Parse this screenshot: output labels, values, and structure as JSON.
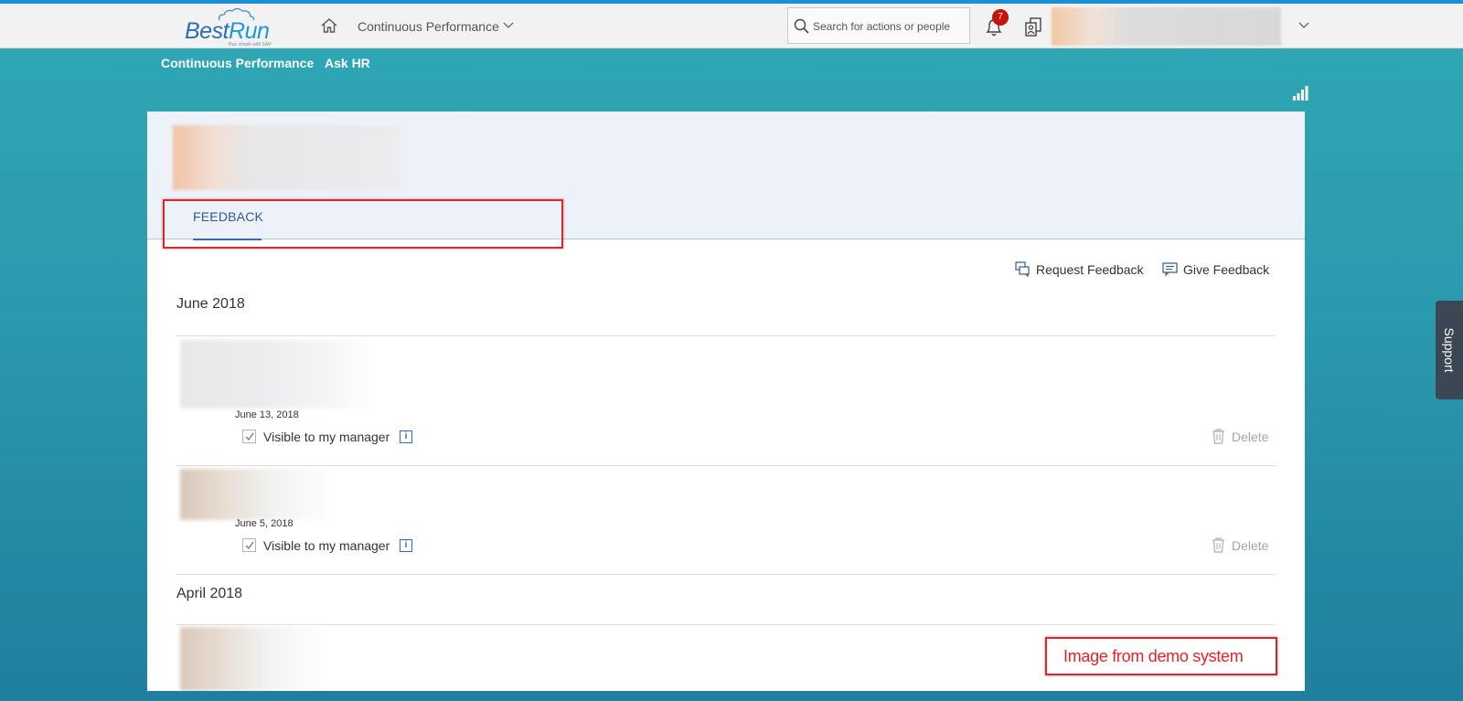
{
  "shell": {
    "logo_best": "Best",
    "logo_run": "Run",
    "logo_tagline": "Run simple with SAP",
    "app_title": "Continuous Performance",
    "search_placeholder": "Search for actions or people",
    "notification_count": "7"
  },
  "subnav": {
    "items": [
      "Continuous Performance",
      "Ask HR"
    ]
  },
  "profile": {
    "tab_label": "FEEDBACK"
  },
  "actions": {
    "request": "Request Feedback",
    "give": "Give Feedback"
  },
  "sections": [
    {
      "title": "June 2018",
      "entries": [
        {
          "date": "June 13, 2018",
          "visible_label": "Visible to my manager",
          "delete_label": "Delete",
          "visible_checked": true
        },
        {
          "date": "June 5, 2018",
          "visible_label": "Visible to my manager",
          "delete_label": "Delete",
          "visible_checked": true
        }
      ]
    },
    {
      "title": "April 2018",
      "entries": []
    }
  ],
  "annotation": "Image from demo system",
  "support_label": "Support",
  "colors": {
    "accent": "#2f6bbf",
    "highlight_border": "#e0242a",
    "badge": "#c2150c",
    "top_line": "#1a8fd6"
  },
  "icons": [
    "home-icon",
    "chevron-down-icon",
    "search-icon",
    "bell-icon",
    "pinned-items-icon",
    "bar-chart-icon",
    "request-feedback-icon",
    "give-feedback-icon",
    "info-icon",
    "checkmark-icon",
    "trash-icon"
  ]
}
